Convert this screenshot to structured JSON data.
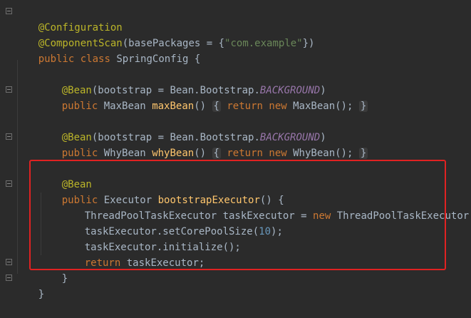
{
  "code": {
    "line1": {
      "annotation": "@Configuration"
    },
    "line2": {
      "annotation": "@ComponentScan",
      "open": "(basePackages = {",
      "string": "\"com.example\"",
      "close": "})"
    },
    "line3": {
      "kw1": "public",
      "kw2": "class",
      "name": "SpringConfig {"
    },
    "line5": {
      "annotation": "@Bean",
      "args": "(bootstrap = Bean.Bootstrap.",
      "constant": "BACKGROUND",
      "close": ")"
    },
    "line6": {
      "kw": "public",
      "type": "MaxBean",
      "method": "maxBean",
      "parens": "()",
      "hint_open": "{",
      "ret": "return",
      "new_kw": "new",
      "ctor": "MaxBean();",
      "hint_close": "}"
    },
    "line8": {
      "annotation": "@Bean",
      "args": "(bootstrap = Bean.Bootstrap.",
      "constant": "BACKGROUND",
      "close": ")"
    },
    "line9": {
      "kw": "public",
      "type": "WhyBean",
      "method": "whyBean",
      "parens": "()",
      "hint_open": "{",
      "ret": "return",
      "new_kw": "new",
      "ctor": "WhyBean();",
      "hint_close": "}"
    },
    "line11": {
      "annotation": "@Bean"
    },
    "line12": {
      "kw": "public",
      "type": "Executor",
      "method": "bootstrapExecutor",
      "rest": "() {"
    },
    "line13": {
      "decl": "ThreadPoolTaskExecutor taskExecutor = ",
      "new_kw": "new",
      "ctor": "ThreadPoolTaskExecutor();"
    },
    "line14": {
      "call": "taskExecutor.setCorePoolSize(",
      "num": "10",
      "close": ");"
    },
    "line15": {
      "call": "taskExecutor.initialize();"
    },
    "line16": {
      "ret": "return",
      "value": "taskExecutor;"
    },
    "line17": {
      "brace": "}"
    },
    "line19": {
      "brace": "}"
    }
  }
}
